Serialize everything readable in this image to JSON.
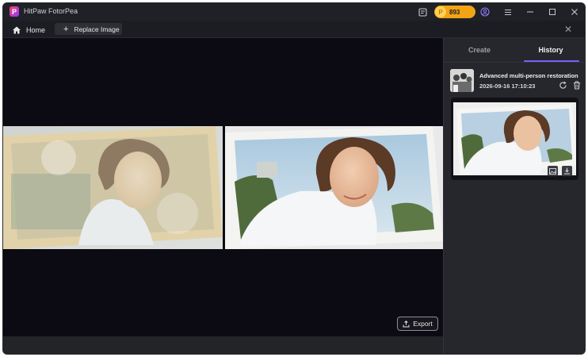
{
  "app": {
    "title": "HitPaw FotorPea",
    "logo_letter": "P",
    "coins": "893",
    "coin_symbol": "P",
    "accent_color": "#7b5cff",
    "coin_color": "#f2a417"
  },
  "tabbar": {
    "home_label": "Home",
    "replace_label": "Replace Image",
    "close_symbol": "✕"
  },
  "canvas": {
    "export_label": "Export"
  },
  "sidebar": {
    "tabs": [
      {
        "label": "Create",
        "active": false
      },
      {
        "label": "History",
        "active": true
      }
    ],
    "history_item": {
      "title": "Advanced multi-person restoration",
      "timestamp": "2026-09-16 17:10:23"
    }
  },
  "window_controls": [
    "minimize-icon",
    "maximize-icon",
    "close-icon"
  ]
}
